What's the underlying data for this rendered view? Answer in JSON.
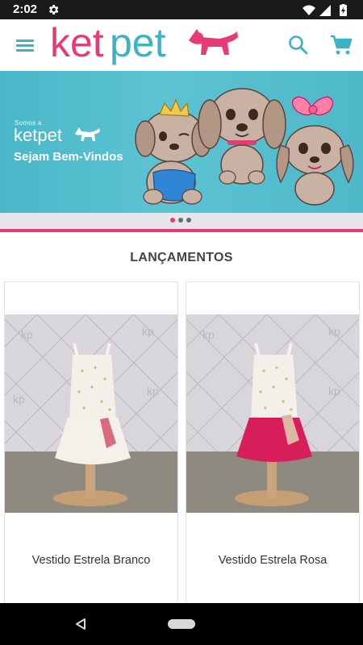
{
  "status_bar": {
    "time": "2:02",
    "icons": [
      "settings-gear-icon",
      "wifi-icon",
      "cell-signal-icon",
      "battery-charging-icon"
    ]
  },
  "app_bar": {
    "logo_text": "ketpet",
    "menu_icon": "hamburger-menu-icon",
    "search_icon": "search-icon",
    "cart_icon": "shopping-cart-icon",
    "accent_color": "#3bb3c3",
    "brand_color": "#e83a74"
  },
  "banner": {
    "somos": "Somos a",
    "brand": "ketpet",
    "welcome": "Sejam Bem-Vindos",
    "background_color": "#52bccb"
  },
  "carousel": {
    "slides": 3,
    "active_index": 0,
    "active_color": "#e83a74",
    "inactive_color": "#6b6b6b"
  },
  "section": {
    "title": "LANÇAMENTOS"
  },
  "products": [
    {
      "name": "Vestido Estrela Branco",
      "skirt_color": "#f4f1ea"
    },
    {
      "name": "Vestido Estrela Rosa",
      "skirt_color": "#d81d5b"
    }
  ],
  "nav_bar": {
    "back_icon": "back-triangle-icon",
    "home_icon": "home-pill-icon"
  }
}
